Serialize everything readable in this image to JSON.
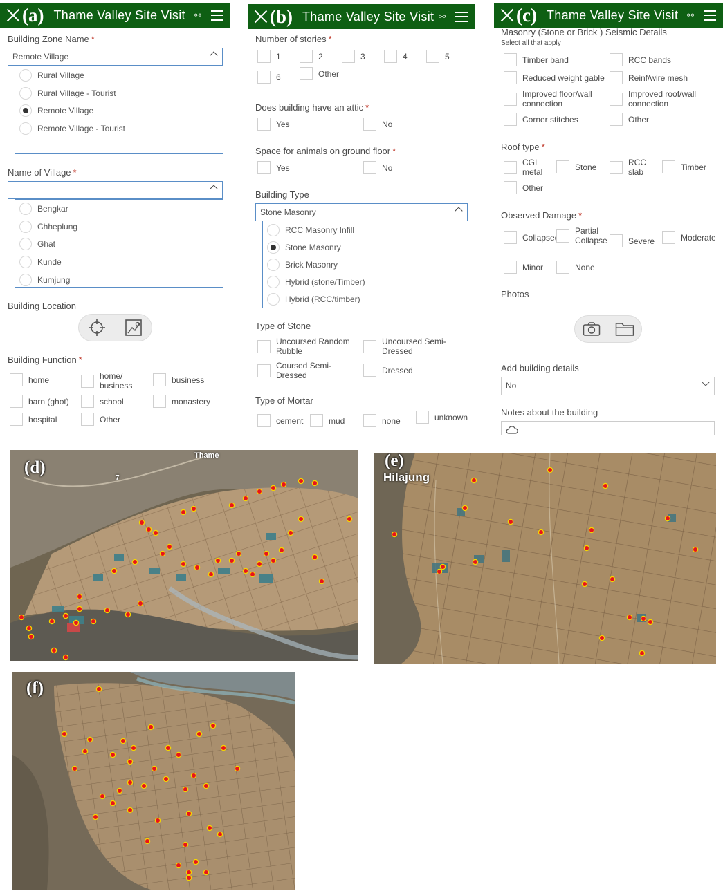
{
  "app_title": "Thame Valley Site Visit",
  "panels": {
    "a": {
      "label": "(a)",
      "zone_label": "Building Zone Name",
      "zone_value": "Remote Village",
      "zone_options": [
        "Rural Village",
        "Rural Village - Tourist",
        "Remote Village",
        "Remote Village - Tourist"
      ],
      "village_label": "Name of Village",
      "village_options": [
        "Bengkar",
        "Chheplung",
        "Ghat",
        "Kunde",
        "Kumjung"
      ],
      "location_label": "Building Location",
      "function_label": "Building Function",
      "function_options": [
        "home",
        "home/ business",
        "business",
        "barn (ghot)",
        "school",
        "monastery",
        "hospital",
        "Other"
      ]
    },
    "b": {
      "label": "(b)",
      "stories_label": "Number of stories",
      "stories_options": [
        "1",
        "2",
        "3",
        "4",
        "5",
        "6",
        "Other"
      ],
      "attic_label": "Does building have an attic",
      "attic_options": [
        "Yes",
        "No"
      ],
      "animals_label": "Space for animals on ground floor",
      "animals_options": [
        "Yes",
        "No"
      ],
      "type_label": "Building Type",
      "type_value": "Stone Masonry",
      "type_options": [
        "RCC Masonry Infill",
        "Stone Masonry",
        "Brick Masonry",
        "Hybrid (stone/Timber)",
        "Hybrid (RCC/timber)"
      ],
      "stone_label": "Type of Stone",
      "stone_options": [
        "Uncoursed Random Rubble",
        "Uncoursed Semi-Dressed",
        "Coursed Semi-Dressed",
        "Dressed"
      ],
      "mortar_label": "Type of Mortar",
      "mortar_options": [
        "cement",
        "mud",
        "none",
        "unknown"
      ]
    },
    "c": {
      "label": "(c)",
      "seismic_label": "Masonry (Stone or Brick ) Seismic Details",
      "seismic_hint": "Select all that apply",
      "seismic_options": [
        "Timber band",
        "RCC bands",
        "Reduced weight gable",
        "Reinf/wire mesh",
        "Improved floor/wall connection",
        "Improved roof/wall connection",
        "Corner stitches",
        "Other"
      ],
      "roof_label": "Roof type",
      "roof_options": [
        "CGI metal",
        "Stone",
        "RCC slab",
        "Timber",
        "Other"
      ],
      "damage_label": "Observed Damage",
      "damage_options": [
        "Collapsed",
        "Partial Collapse",
        "Severe",
        "Moderate",
        "Minor",
        "None"
      ],
      "photos_label": "Photos",
      "details_label": "Add building details",
      "details_value": "No",
      "notes_label": "Notes about the building"
    }
  },
  "maps": {
    "d": {
      "label": "(d)",
      "place": "Thame",
      "road": "7"
    },
    "e": {
      "label": "(e)",
      "place": "Hilajung"
    },
    "f": {
      "label": "(f)"
    }
  },
  "colors": {
    "header": "#0e5f13",
    "accent": "#5a8ec7",
    "marker": "#e8141b",
    "required": "#c0392b"
  }
}
